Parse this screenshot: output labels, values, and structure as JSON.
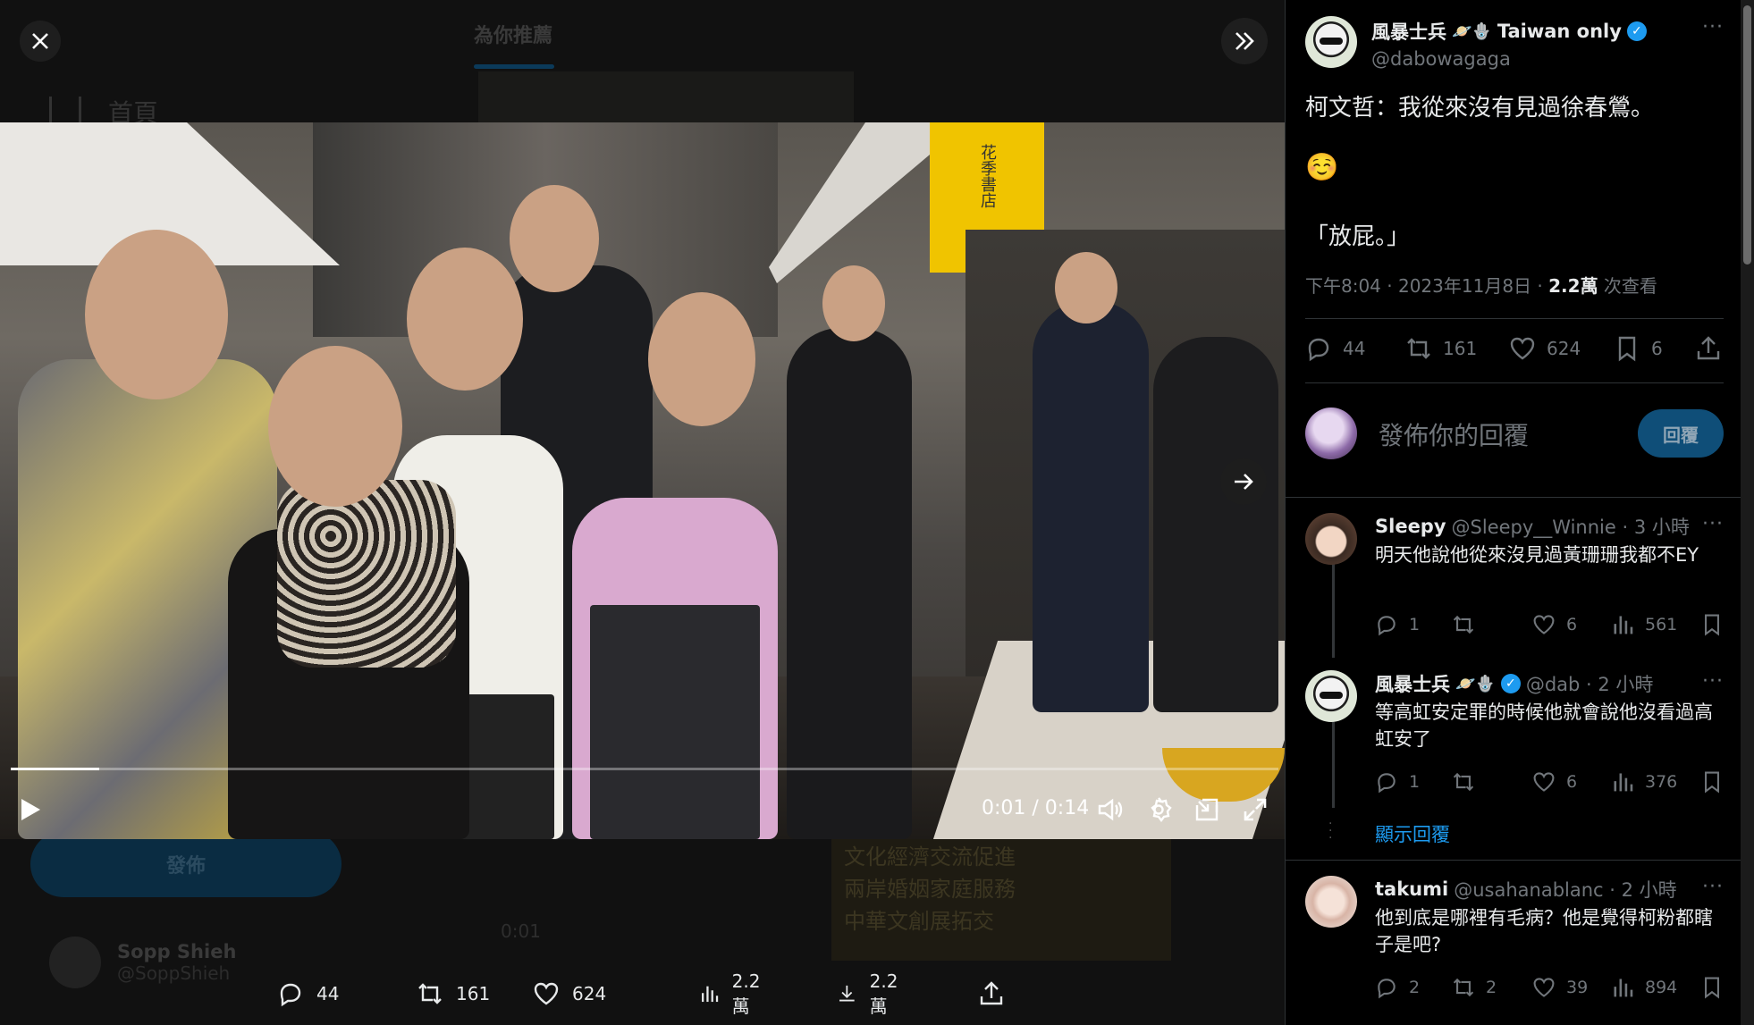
{
  "background": {
    "tab_active": "為你推薦",
    "home_label": "首頁",
    "post_button": "發佈",
    "user_name": "Sopp Shieh",
    "user_handle": "@SoppShieh",
    "doc_lines": [
      "文化經濟交流促進",
      "兩岸婚姻家庭服務",
      "中華文創展拓交"
    ],
    "mini_time": "0:01"
  },
  "video": {
    "time": "0:01 / 0:14",
    "progress": 0.07,
    "sign_text": "花季書店"
  },
  "media_actions": {
    "replies": "44",
    "retweets": "161",
    "likes": "624",
    "views": "2.2萬",
    "downloads": "2.2萬"
  },
  "tweet": {
    "author_name": "風暴士兵",
    "author_name_suffix": "Taiwan only",
    "author_emojis": "🪐🪬",
    "author_handle": "@dabowagaga",
    "line1": "柯文哲：我從來沒有見過徐春鶯。",
    "line2": "☺️",
    "line3": "「放屁。」",
    "time": "下午8:04 · 2023年11月8日 · ",
    "views_count": "2.2萬",
    "views_label": " 次查看",
    "stats": {
      "replies": "44",
      "retweets": "161",
      "likes": "624",
      "bookmarks": "6"
    }
  },
  "reply_box": {
    "placeholder": "發佈你的回覆",
    "button": "回覆"
  },
  "replies": [
    {
      "name": "Sleepy",
      "handle": "@Sleepy__Winnie · 3 小時",
      "text": "明天他說他從來沒見過黃珊珊我都不EY",
      "replies": "1",
      "retweets": "",
      "likes": "6",
      "views": "561"
    },
    {
      "name": "風暴士兵",
      "emojis": "🪐🪬",
      "handle": "@dab · 2 小時",
      "text": "等高虹安定罪的時候他就會說他沒看過高虹安了",
      "replies": "1",
      "retweets": "",
      "likes": "6",
      "views": "376"
    },
    {
      "name": "takumi",
      "handle": "@usahanablanc · 2 小時",
      "text": "他到底是哪裡有毛病？他是覺得柯粉都瞎子是吧?",
      "replies": "2",
      "retweets": "2",
      "likes": "39",
      "views": "894"
    }
  ],
  "show_replies": "顯示回覆",
  "colors": {
    "accent": "#1d9bf0",
    "muted": "#71767b",
    "text": "#e7e9ea",
    "reply_button_bg": "#0f4e78"
  }
}
